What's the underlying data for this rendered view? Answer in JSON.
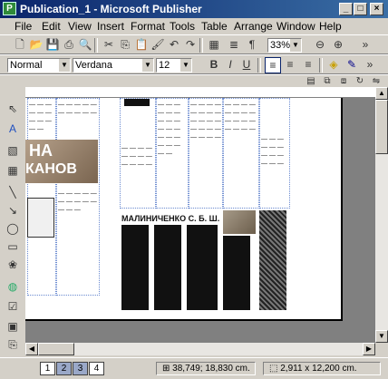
{
  "window": {
    "title": "Publication_1 - Microsoft Publisher",
    "app_icon": "publisher-icon"
  },
  "menu": [
    "File",
    "Edit",
    "View",
    "Insert",
    "Format",
    "Tools",
    "Table",
    "Arrange",
    "Window",
    "Help"
  ],
  "standard_toolbar": {
    "zoom": "33%"
  },
  "format_toolbar": {
    "style": "Normal",
    "font": "Verdana",
    "size": "12"
  },
  "document": {
    "logo_text_1": "НА",
    "logo_text_2": "КАНОВ",
    "heading": "МАЛИНИЧЕНКО С. Б. Ш."
  },
  "status": {
    "pages": [
      "1",
      "2",
      "3",
      "4"
    ],
    "position": "38,749; 18,830 cm.",
    "size": "2,911 x 12,200 cm."
  }
}
